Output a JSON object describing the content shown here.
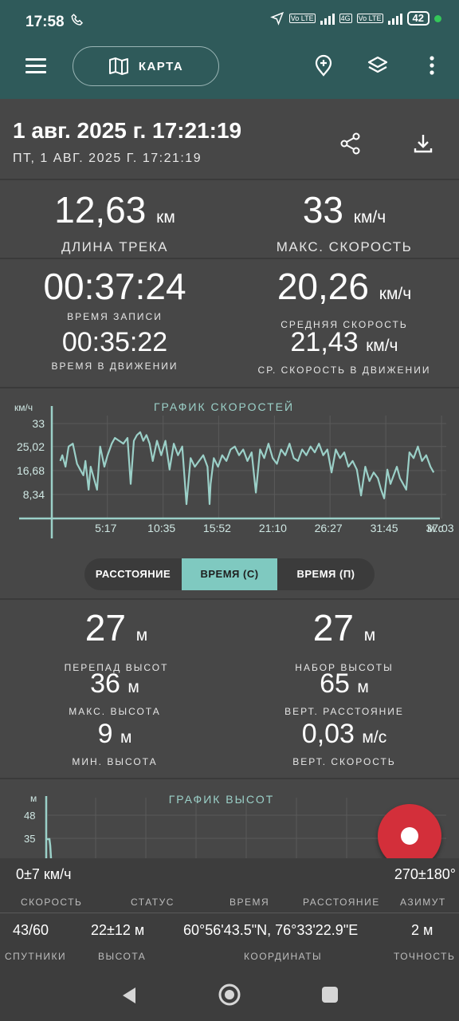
{
  "status_bar": {
    "time": "17:58",
    "battery": "42",
    "tags": [
      "Vo LTE",
      "4G",
      "Vo LTE"
    ]
  },
  "toolbar": {
    "map_label": "КАРТА",
    "icons": [
      "menu-icon",
      "map-icon",
      "add-marker-icon",
      "layers-icon",
      "more-icon"
    ]
  },
  "header": {
    "title": "1 авг. 2025 г. 17:21:19",
    "subtitle": "ПТ, 1 АВГ. 2025 Г. 17:21:19"
  },
  "stats": {
    "length": {
      "value": "12,63",
      "unit": "км",
      "label": "ДЛИНА ТРЕКА"
    },
    "max_speed": {
      "value": "33",
      "unit": "км/ч",
      "label": "МАКС. СКОРОСТЬ"
    },
    "record_time": {
      "value": "00:37:24",
      "label": "ВРЕМЯ ЗАПИСИ"
    },
    "avg_speed": {
      "value": "20,26",
      "unit": "км/ч",
      "label": "СРЕДНЯЯ СКОРОСТЬ"
    },
    "moving_time": {
      "value": "00:35:22",
      "label": "ВРЕМЯ В ДВИЖЕНИИ"
    },
    "avg_moving_speed": {
      "value": "21,43",
      "unit": "км/ч",
      "label": "СР. СКОРОСТЬ В ДВИЖЕНИИ"
    }
  },
  "speed_chart": {
    "title": "ГРАФИК СКОРОСТЕЙ",
    "y_unit": "км/ч",
    "x_unit": "м:с"
  },
  "chart_data": [
    {
      "type": "line",
      "title": "ГРАФИК СКОРОСТЕЙ",
      "ylabel": "км/ч",
      "xlabel": "м:с",
      "y_ticks": [
        "33",
        "25,02",
        "16,68",
        "8,34"
      ],
      "x_ticks": [
        "5:17",
        "10:35",
        "15:52",
        "21:10",
        "26:27",
        "31:45",
        "37:03"
      ],
      "ylim": [
        0,
        33
      ],
      "xlim": [
        0,
        37.5
      ],
      "grid": true,
      "x": [
        0.8,
        1.0,
        1.3,
        1.6,
        2.0,
        2.4,
        2.7,
        3.0,
        3.2,
        3.5,
        3.7,
        4.0,
        4.3,
        4.6,
        5.0,
        5.3,
        5.7,
        6.0,
        6.4,
        6.8,
        7.2,
        7.5,
        7.8,
        8.1,
        8.4,
        8.7,
        9.0,
        9.3,
        9.6,
        10.0,
        10.4,
        10.8,
        11.2,
        11.6,
        12.0,
        12.4,
        12.8,
        13.2,
        13.6,
        14.0,
        14.4,
        14.8,
        15.0,
        15.1,
        15.4,
        15.8,
        16.2,
        16.6,
        17.0,
        17.4,
        17.8,
        18.2,
        18.6,
        19.0,
        19.4,
        19.8,
        20.2,
        20.6,
        21.0,
        21.4,
        21.8,
        22.2,
        22.6,
        23.0,
        23.4,
        23.8,
        24.2,
        24.6,
        25.0,
        25.4,
        25.8,
        26.2,
        26.6,
        27.0,
        27.4,
        27.8,
        28.2,
        28.6,
        29.0,
        29.4,
        29.8,
        30.2,
        30.6,
        31.0,
        31.3,
        31.6,
        31.9,
        32.2,
        32.5,
        32.8,
        33.1,
        33.4,
        33.7,
        34.0,
        34.4,
        34.8,
        35.2,
        35.6,
        36.0,
        36.3
      ],
      "y": [
        20,
        22,
        18,
        25,
        26,
        19,
        17,
        15,
        20,
        10,
        18,
        14,
        10,
        25,
        18,
        22,
        26,
        28,
        27,
        26,
        28,
        12,
        27,
        29,
        30,
        27,
        29,
        26,
        20,
        27,
        22,
        27,
        17,
        26,
        22,
        25,
        5,
        21,
        18,
        20,
        22,
        18,
        5,
        12,
        21,
        18,
        22,
        20,
        24,
        25,
        22,
        24,
        20,
        23,
        9,
        24,
        21,
        26,
        21,
        19,
        24,
        22,
        26,
        21,
        20,
        24,
        22,
        25,
        23,
        26,
        22,
        24,
        16,
        24,
        21,
        23,
        18,
        20,
        17,
        8,
        18,
        13,
        16,
        14,
        10,
        7,
        17,
        12,
        15,
        18,
        14,
        12,
        10,
        23,
        21,
        25,
        20,
        22,
        18,
        16
      ]
    },
    {
      "type": "line",
      "title": "ГРАФИК ВЫСОТ",
      "ylabel": "м",
      "y_ticks": [
        "48",
        "35"
      ],
      "partial": true
    }
  ],
  "mode_tabs": [
    {
      "label": "РАССТОЯНИЕ",
      "active": false
    },
    {
      "label": "ВРЕМЯ (С)",
      "active": true
    },
    {
      "label": "ВРЕМЯ (П)",
      "active": false
    }
  ],
  "elevation": {
    "drop": {
      "value": "27",
      "unit": "м",
      "label": "ПЕРЕПАД ВЫСОТ"
    },
    "gain": {
      "value": "27",
      "unit": "м",
      "label": "НАБОР ВЫСОТЫ"
    },
    "max": {
      "value": "36",
      "unit": "м",
      "label": "МАКС. ВЫСОТА"
    },
    "vert_distance": {
      "value": "65",
      "unit": "м",
      "label": "ВЕРТ. РАССТОЯНИЕ"
    },
    "min": {
      "value": "9",
      "unit": "м",
      "label": "МИН. ВЫСОТА"
    },
    "vert_speed": {
      "value": "0,03",
      "unit": "м/с",
      "label": "ВЕРТ. СКОРОСТЬ"
    }
  },
  "elevation_chart": {
    "title": "ГРАФИК ВЫСОТ",
    "y_unit": "м",
    "y_ticks": [
      "48",
      "35"
    ]
  },
  "bottom_panel": {
    "speed": "0±7 км/ч",
    "azimuth_value": "270±180°",
    "labels_row1": [
      "СКОРОСТЬ",
      "СТАТУС",
      "ВРЕМЯ",
      "РАССТОЯНИЕ",
      "АЗИМУТ"
    ],
    "satellites": "43/60",
    "altitude": "22±12 м",
    "coordinates": "60°56'43.5\"N, 76°33'22.9\"E",
    "accuracy": "2 м",
    "labels_row2": [
      "СПУТНИКИ",
      "ВЫСОТА",
      "КООРДИНАТЫ",
      "ТОЧНОСТЬ"
    ]
  },
  "colors": {
    "toolbar": "#2f5a5a",
    "background": "#474747",
    "accent": "#7fc9c0",
    "record": "#d32f3a"
  }
}
